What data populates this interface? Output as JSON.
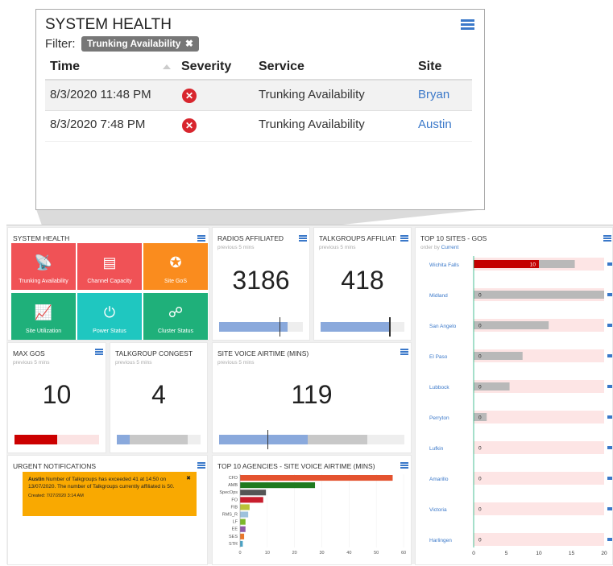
{
  "popup": {
    "title": "SYSTEM HEALTH",
    "filter_label": "Filter:",
    "filter_chip": "Trunking Availability",
    "filter_chip_close": "✖",
    "columns": [
      "Time",
      "Severity",
      "Service",
      "Site"
    ],
    "rows": [
      {
        "time": "8/3/2020 11:48 PM",
        "service": "Trunking Availability",
        "site": "Bryan"
      },
      {
        "time": "8/3/2020 7:48 PM",
        "service": "Trunking Availability",
        "site": "Austin"
      }
    ]
  },
  "system_health": {
    "title": "SYSTEM HEALTH",
    "tiles": [
      {
        "label": "Trunking Availability",
        "icon": "satellite-dish-icon",
        "color": "#f05256"
      },
      {
        "label": "Channel Capacity",
        "icon": "server-rack-icon",
        "color": "#f05256"
      },
      {
        "label": "Site GoS",
        "icon": "award-medal-icon",
        "color": "#fa8c1e"
      },
      {
        "label": "Site Utilization",
        "icon": "line-chart-icon",
        "color": "#1fb07a"
      },
      {
        "label": "Power Status",
        "icon": "power-plug-icon",
        "color": "#1fc7c0"
      },
      {
        "label": "Cluster Status",
        "icon": "cluster-network-icon",
        "color": "#1fb07a"
      }
    ]
  },
  "radios": {
    "title": "RADIOS AFFILIATED",
    "sub": "previous 5 mins",
    "value": "3186",
    "fill": 0.82,
    "marker": 0.72
  },
  "talkgroups": {
    "title": "TALKGROUPS AFFILIATED",
    "sub": "previous 5 mins",
    "value": "418",
    "fill": 0.82,
    "marker": 0.82
  },
  "max_gos": {
    "title": "MAX GoS",
    "sub": "previous 5 mins",
    "value": "10",
    "fill": 0.5
  },
  "tg_congestion": {
    "title": "TALKGROUP CONGESTION",
    "sub": "previous 5 mins",
    "value": "4",
    "fill": 0.15,
    "fill2": 0.85
  },
  "site_voice": {
    "title": "SITE VOICE AIRTIME (MINS)",
    "sub": "previous 5 mins",
    "value": "119",
    "fill": 0.48,
    "fill2": 0.8,
    "marker": 0.26
  },
  "urgent": {
    "title": "URGENT NOTIFICATIONS",
    "site": "Austin",
    "message": " Number of Talkgroups has exceeded 41 at 14:50 on 13/07/2020. The number of Talkgroups currently affiliated is 50.",
    "created": "Created: 7/27/2020 3:14 AM",
    "close": "✖",
    "color": "#f9a901"
  },
  "top_agencies": {
    "title": "TOP 10 AGENCIES - SITE VOICE AIRTIME (MINS)"
  },
  "top_sites": {
    "title": "TOP 10 SITES - GoS",
    "order_prefix": "order by",
    "order_link": "Current"
  },
  "chart_data": [
    {
      "type": "bar",
      "orientation": "horizontal",
      "categories": [
        "CFD",
        "AMB",
        "SpecOps",
        "FO",
        "FIB",
        "RMS_R",
        "LF",
        "EE",
        "SES",
        "STR"
      ],
      "values": [
        56,
        27.5,
        9.5,
        8.5,
        3.5,
        3,
        2,
        2,
        1.5,
        1
      ],
      "colors": [
        "#e4532f",
        "#1f7a1f",
        "#555555",
        "#c81e2d",
        "#b9c238",
        "#9ec2dc",
        "#7cb82a",
        "#8e5aa8",
        "#e9772b",
        "#4aa3c6"
      ],
      "xlim": [
        0,
        60
      ],
      "xticks": [
        0,
        10,
        20,
        30,
        40,
        50,
        60
      ]
    },
    {
      "type": "bar",
      "orientation": "horizontal",
      "categories": [
        "Wichita Falls",
        "Midland",
        "San Angelo",
        "El Paso",
        "Lubbock",
        "Perryton",
        "Lufkin",
        "Amarillo",
        "Victoria",
        "Harlingen"
      ],
      "current": [
        10,
        0,
        0,
        0,
        0,
        0,
        0,
        0,
        0,
        0
      ],
      "previous": [
        15.5,
        20,
        11.5,
        7.5,
        5.5,
        2,
        0,
        0,
        0,
        0
      ],
      "xlim": [
        0,
        20
      ],
      "xticks": [
        0,
        5,
        10,
        15,
        20
      ]
    }
  ]
}
